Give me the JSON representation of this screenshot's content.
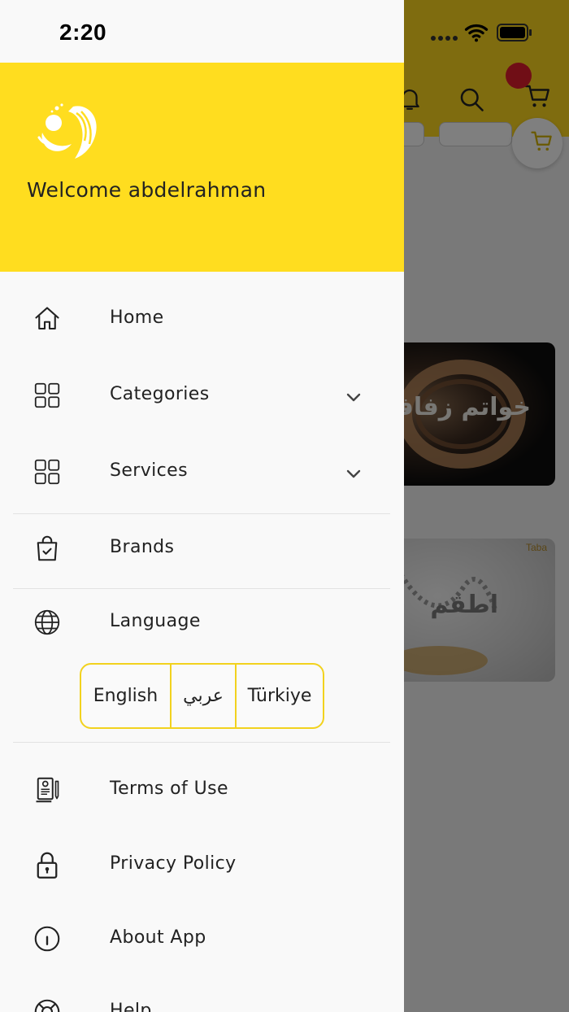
{
  "status_bar": {
    "time": "2:20"
  },
  "drawer": {
    "welcome": "Welcome abdelrahman",
    "menu": {
      "home": "Home",
      "categories": "Categories",
      "services": "Services",
      "brands": "Brands",
      "language": "Language",
      "terms": "Terms of Use",
      "privacy": "Privacy Policy",
      "about": "About App",
      "help": "Help"
    },
    "languages": [
      "English",
      "عربي",
      "Türkiye"
    ],
    "icons": {
      "home": "home-icon",
      "categories": "grid-icon",
      "services": "grid-icon",
      "brands": "shopping-bag-icon",
      "language": "globe-icon",
      "terms": "document-icon",
      "privacy": "lock-icon",
      "about": "info-icon",
      "help": "lifebuoy-icon"
    }
  },
  "background": {
    "banner_1_text": "خواتم زفاف",
    "banner_2_text": "اطقم",
    "banner_2_brand": "Taba"
  },
  "colors": {
    "brand_yellow": "#ffdd1f",
    "badge_red": "#e11d2c",
    "drawer_bg": "#f9f9f9"
  }
}
